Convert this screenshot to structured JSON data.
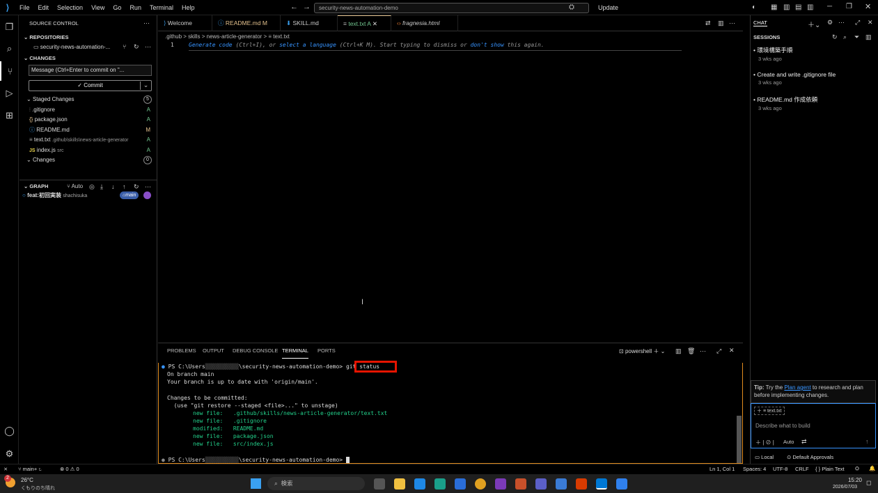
{
  "titlebar": {
    "menu": [
      "File",
      "Edit",
      "Selection",
      "View",
      "Go",
      "Run",
      "Terminal",
      "Help"
    ],
    "search_text": "security-news-automation-demo",
    "update_label": "Update"
  },
  "source_control": {
    "title": "SOURCE CONTROL",
    "repositories_header": "REPOSITORIES",
    "repo_name": "security-news-automation-...",
    "changes_header": "CHANGES",
    "message_placeholder": "Message (Ctrl+Enter to commit on \"...",
    "commit_label": "Commit",
    "staged_label": "Staged Changes",
    "staged_count": "5",
    "files": [
      {
        "icon": "{}",
        "name": ".gitignore",
        "path": "",
        "status": "A"
      },
      {
        "icon": "{}",
        "name": "package.json",
        "path": "",
        "status": "A"
      },
      {
        "icon": "ⓘ",
        "name": "README.md",
        "path": "",
        "status": "M"
      },
      {
        "icon": "≡",
        "name": "text.txt",
        "path": ".github\\skills\\news-article-generator",
        "status": "A"
      },
      {
        "icon": "JS",
        "name": "index.js",
        "path": "src",
        "status": "A"
      }
    ],
    "changes_label": "Changes",
    "changes_count": "0",
    "graph_header": "GRAPH",
    "graph_auto": "Auto",
    "commit_msg": "feat:初回実装",
    "commit_author": "shachisuka",
    "commit_branch": "main"
  },
  "tabs": [
    {
      "label": "Welcome",
      "suffix": ""
    },
    {
      "label": "README.md",
      "suffix": "M"
    },
    {
      "label": "SKILL.md",
      "suffix": ""
    },
    {
      "label": "text.txt",
      "suffix": "A"
    },
    {
      "label": "fragnesia.html",
      "suffix": ""
    }
  ],
  "breadcrumb": [
    ".github",
    "skills",
    "news-article-generator",
    "text.txt"
  ],
  "editor": {
    "line_number": "1",
    "hint_1": "Generate code",
    "hint_2": " (Ctrl+I), or ",
    "hint_3": "select a language",
    "hint_4": " (Ctrl+K M). Start typing to dismiss or ",
    "hint_5": "don't show",
    "hint_6": " this again."
  },
  "panel": {
    "tabs": [
      "PROBLEMS",
      "OUTPUT",
      "DEBUG CONSOLE",
      "TERMINAL",
      "PORTS"
    ],
    "shell": "powershell",
    "prompt_prefix": "PS C:\\Users",
    "prompt_suffix": "\\security-news-automation-demo>",
    "command": "git status",
    "lines": [
      "On branch main",
      "Your branch is up to date with 'origin/main'.",
      "",
      "Changes to be committed:",
      "  (use \"git restore --staged <file>...\" to unstage)"
    ],
    "changes": [
      {
        "kind": "new file:",
        "file": ".github/skills/news-article-generator/text.txt"
      },
      {
        "kind": "new file:",
        "file": ".gitignore"
      },
      {
        "kind": "modified:",
        "file": "README.md"
      },
      {
        "kind": "new file:",
        "file": "package.json"
      },
      {
        "kind": "new file:",
        "file": "src/index.js"
      }
    ]
  },
  "chat": {
    "title": "CHAT",
    "sessions_header": "SESSIONS",
    "sessions": [
      {
        "title": "環境構築手順",
        "time": "3 wks ago"
      },
      {
        "title": "Create and write .gitignore file",
        "time": "3 wks ago"
      },
      {
        "title": "README.md 作成依頼",
        "time": "3 wks ago"
      }
    ],
    "tip_prefix": "Tip:",
    "tip_text1": " Try the ",
    "tip_link": "Plan agent",
    "tip_text2": " to research and plan before implementing changes.",
    "context_file": "text.txt",
    "input_placeholder": "Describe what to build",
    "mode": "Auto",
    "local_label": "Local",
    "approvals_label": "Default Approvals"
  },
  "statusbar": {
    "branch": "main+",
    "errors": "0",
    "warnings": "0",
    "position": "Ln 1, Col 1",
    "spaces": "Spaces: 4",
    "encoding": "UTF-8",
    "eol": "CRLF",
    "language": "Plain Text"
  },
  "taskbar": {
    "temp": "26°C",
    "weather": "くもりのち晴れ",
    "weather_badge": "2",
    "search": "検索",
    "time": "15:20",
    "date": "2026/07/03"
  },
  "colors": {
    "accent": "#0078d4",
    "highlight_box": "#e51400",
    "added": "#73c991",
    "modified": "#e2c08d",
    "terminal_green": "#23d18b"
  }
}
